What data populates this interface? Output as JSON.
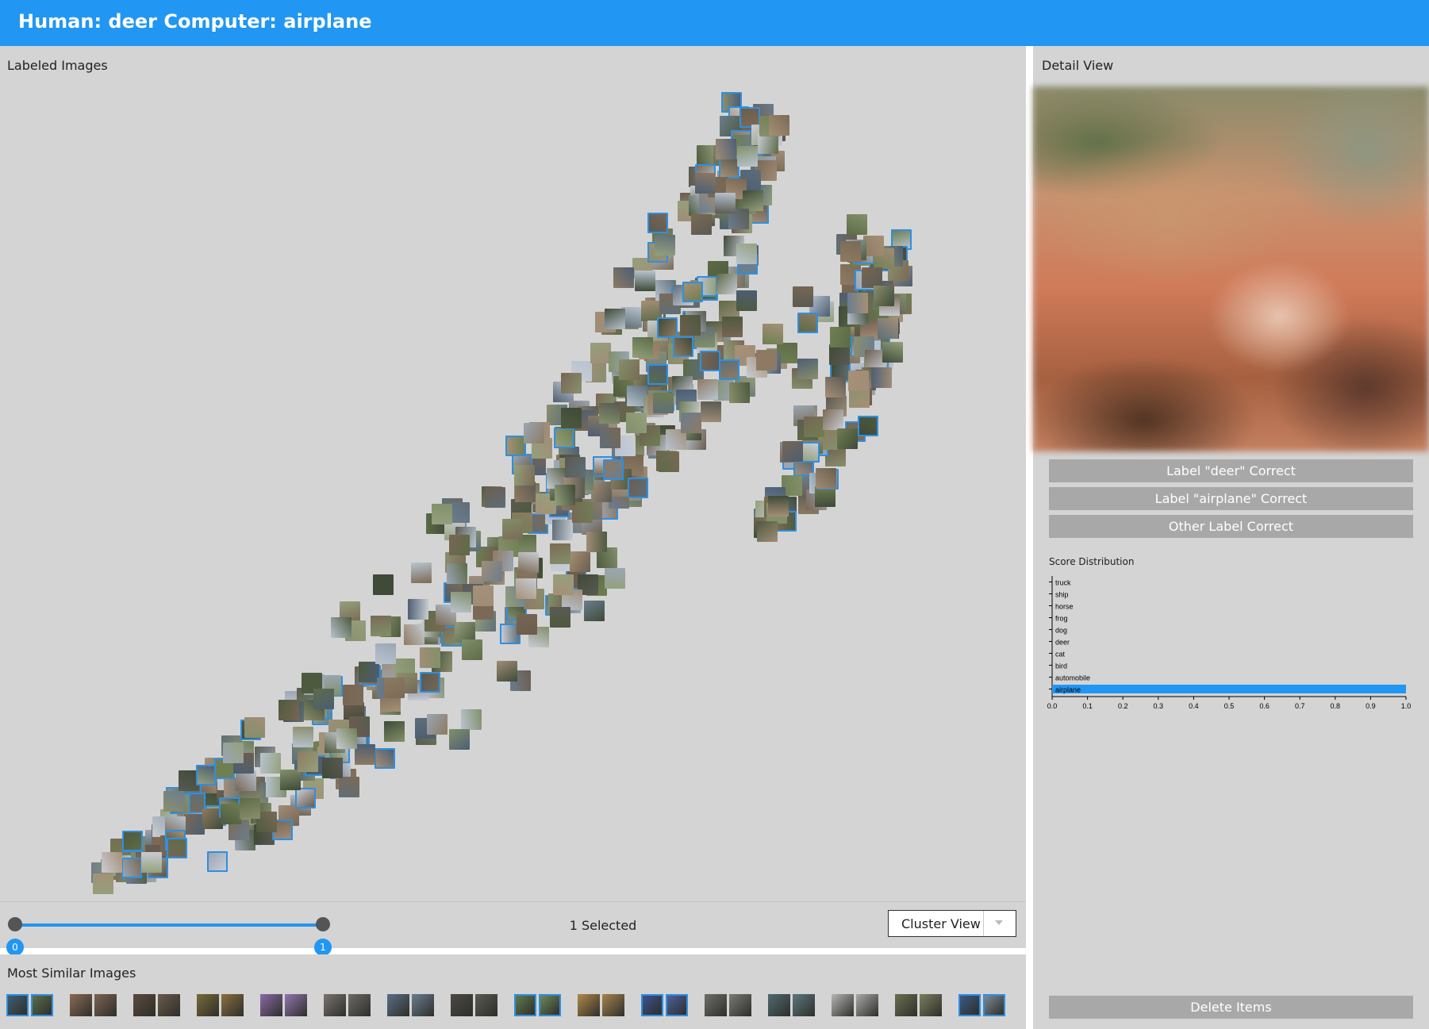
{
  "header": {
    "title": "Human: deer Computer: airplane"
  },
  "left_panel": {
    "title": "Labeled Images"
  },
  "controls": {
    "slider_min": "0",
    "slider_max": "1",
    "selected_text": "1 Selected",
    "view_select_value": "Cluster View"
  },
  "similar": {
    "title": "Most Similar Images",
    "pairs": [
      {
        "c1": "#3e5f73",
        "c2": "#5b6e4a",
        "sel": true
      },
      {
        "c1": "#8b6b55",
        "c2": "#7d6351",
        "sel": false
      },
      {
        "c1": "#5c4a3d",
        "c2": "#6b5a4b",
        "sel": false
      },
      {
        "c1": "#7a6a3a",
        "c2": "#8a6f40",
        "sel": false
      },
      {
        "c1": "#8a6aa8",
        "c2": "#9274b0",
        "sel": false
      },
      {
        "c1": "#7a7470",
        "c2": "#6e6a66",
        "sel": false
      },
      {
        "c1": "#5a6e86",
        "c2": "#6a7d90",
        "sel": false
      },
      {
        "c1": "#4b4a44",
        "c2": "#5a5a52",
        "sel": false
      },
      {
        "c1": "#5f7a4e",
        "c2": "#6c8858",
        "sel": true
      },
      {
        "c1": "#b08a48",
        "c2": "#a68450",
        "sel": false
      },
      {
        "c1": "#3a5290",
        "c2": "#4a609c",
        "sel": true
      },
      {
        "c1": "#6e6e6a",
        "c2": "#7a7a74",
        "sel": false
      },
      {
        "c1": "#4e6a72",
        "c2": "#5c787e",
        "sel": false
      },
      {
        "c1": "#b6b6b6",
        "c2": "#a8a8a8",
        "sel": false
      },
      {
        "c1": "#6a7050",
        "c2": "#7a7e5c",
        "sel": false
      },
      {
        "c1": "#3a5a82",
        "c2": "#7a8a96",
        "sel": true
      }
    ]
  },
  "detail": {
    "title": "Detail View",
    "buttons": {
      "deer_correct": "Label \"deer\" Correct",
      "airplane_correct": "Label \"airplane\" Correct",
      "other_correct": "Other Label Correct",
      "delete": "Delete Items"
    }
  },
  "score": {
    "title": "Score Distribution",
    "categories": [
      "truck",
      "ship",
      "horse",
      "frog",
      "dog",
      "deer",
      "cat",
      "bird",
      "automobile",
      "airplane"
    ],
    "values": [
      0,
      0,
      0,
      0,
      0,
      0,
      0,
      0,
      0,
      1.0
    ],
    "x_ticks": [
      "0.0",
      "0.1",
      "0.2",
      "0.3",
      "0.4",
      "0.5",
      "0.6",
      "0.7",
      "0.8",
      "0.9",
      "1.0"
    ],
    "highlight_color": "#2196f3"
  },
  "scatter": {
    "points": [],
    "palette": [
      "#6f7f52",
      "#5d6b47",
      "#8a8f6d",
      "#7a6a55",
      "#5a5a52",
      "#9aa6b4",
      "#b8c4d0",
      "#6b7d8e",
      "#4e5a3e",
      "#8e7a62",
      "#a08d77",
      "#3f4a38",
      "#c9ccd4",
      "#776655",
      "#5e6e78",
      "#4c5e73",
      "#82906a",
      "#a59077",
      "#6c5d4e",
      "#94a07c"
    ]
  }
}
